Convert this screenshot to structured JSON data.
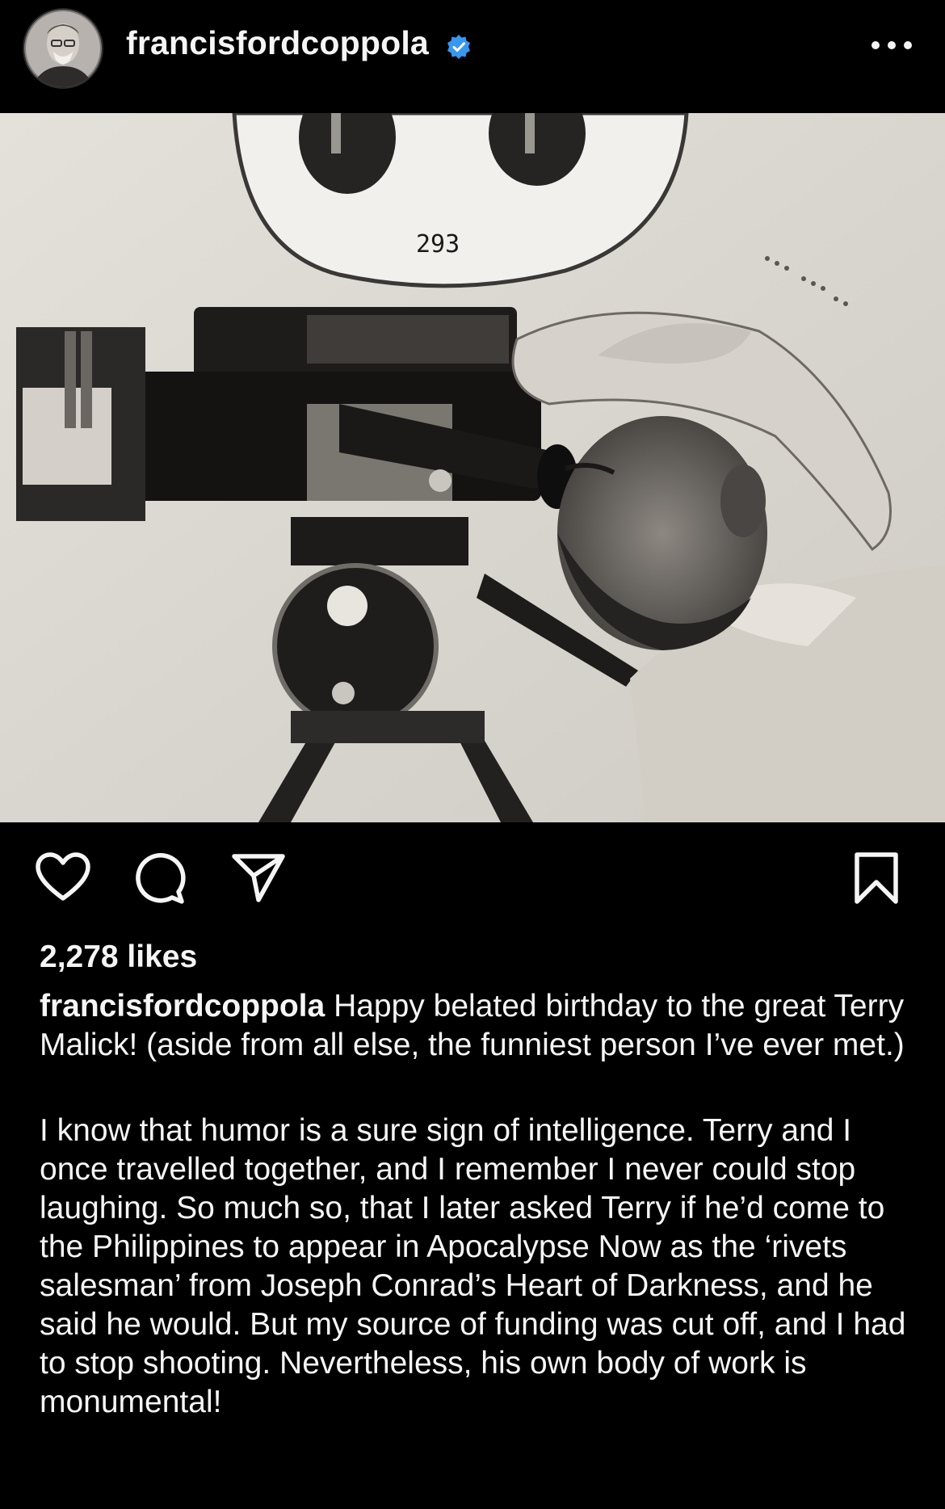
{
  "post": {
    "username": "francisfordcoppola",
    "verified": true,
    "photo_annotation": "293",
    "likes": "2,278 likes",
    "caption_author": "francisfordcoppola",
    "caption_line1": "Happy belated birthday to the great Terry Malick! (aside from all else, the funniest person I’ve ever met.)",
    "caption_paragraph2": "I know that humor is a sure sign of intelligence. Terry and I once travelled together, and I remember I never could stop laughing. So much so, that I later asked Terry if he’d come to the Philippines to appear in Apocalypse Now as the ‘rivets salesman’ from Joseph Conrad’s Heart of Darkness, and he said he would. But my source of funding was cut off, and I had to stop shooting. Nevertheless,  his own body of work is monumental!"
  },
  "icons": {
    "avatar": "profile-photo",
    "verified": "verified-badge-icon",
    "more": "more-options-icon",
    "like": "heart-icon",
    "comment": "comment-bubble-icon",
    "share": "paper-plane-icon",
    "save": "bookmark-icon"
  },
  "colors": {
    "background": "#000000",
    "text": "#f5f5f5",
    "verified_blue": "#3897f0"
  }
}
